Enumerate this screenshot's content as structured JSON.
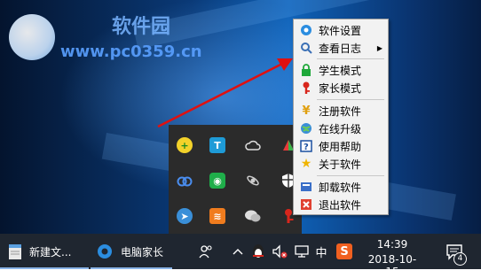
{
  "watermark": {
    "title": "软件园",
    "url": "www.pc0359.cn"
  },
  "context_menu": {
    "items": [
      {
        "label": "软件设置",
        "icon": "gear-icon"
      },
      {
        "label": "查看日志",
        "icon": "magnifier-icon",
        "submenu": "▶"
      },
      {
        "label": "学生模式",
        "icon": "padlock-icon"
      },
      {
        "label": "家长模式",
        "icon": "key-icon"
      },
      {
        "label": "注册软件",
        "icon": "yen-icon"
      },
      {
        "label": "在线升级",
        "icon": "globe-icon"
      },
      {
        "label": "使用帮助",
        "icon": "help-icon"
      },
      {
        "label": "关于软件",
        "icon": "star-icon"
      },
      {
        "label": "卸载软件",
        "icon": "uninstall-icon"
      },
      {
        "label": "退出软件",
        "icon": "exit-icon"
      }
    ]
  },
  "tray_overflow": {
    "icons": [
      "add-green-icon",
      "text-t-icon",
      "cloud-icon",
      "colorful-icon",
      "baidu-cloud-icon",
      "eye-icon",
      "satellite-icon",
      "shield-icon",
      "feather-icon",
      "sound-wave-icon",
      "wechat-icon",
      "parent-key-icon"
    ]
  },
  "taskbar": {
    "apps": [
      {
        "label": "新建文...",
        "icon": "notepad-icon"
      },
      {
        "label": "电脑家长",
        "icon": "gear-blue-icon"
      }
    ],
    "ime_label": "中",
    "sogou_label": "S",
    "clock": {
      "time": "14:39",
      "date": "2018-10-15"
    },
    "notification_count": "4"
  },
  "colors": {
    "accent": "#8ab4e8",
    "arrow": "#e01010",
    "taskbar": "#1f2630"
  }
}
